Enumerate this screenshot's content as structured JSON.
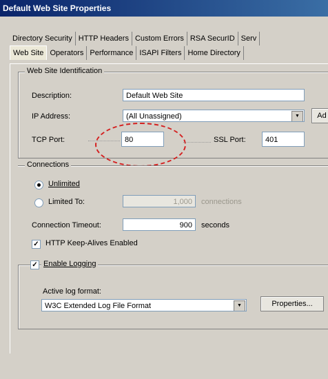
{
  "window": {
    "title": "Default Web Site Properties"
  },
  "tabs_row1": [
    "Directory Security",
    "HTTP Headers",
    "Custom Errors",
    "RSA SecurID",
    "Serv"
  ],
  "tabs_row2": [
    "Web Site",
    "Operators",
    "Performance",
    "ISAPI Filters",
    "Home Directory"
  ],
  "identification": {
    "legend": "Web Site Identification",
    "description_label": "Description:",
    "description_value": "Default Web Site",
    "ip_label": "IP Address:",
    "ip_value": "(All Unassigned)",
    "advanced_label": "Ad",
    "tcp_label": "TCP Port:",
    "tcp_value": "80",
    "ssl_label": "SSL Port:",
    "ssl_value": "401"
  },
  "connections": {
    "legend": "Connections",
    "unlimited_label": "Unlimited",
    "limited_label": "Limited To:",
    "limited_value": "1,000",
    "connections_unit": "connections",
    "timeout_label": "Connection Timeout:",
    "timeout_value": "900",
    "timeout_unit": "seconds",
    "keepalive_label": "HTTP Keep-Alives Enabled"
  },
  "logging": {
    "enable_label": "Enable Logging",
    "active_format_label": "Active log format:",
    "active_format_value": "W3C Extended Log File Format",
    "properties_label": "Properties..."
  }
}
